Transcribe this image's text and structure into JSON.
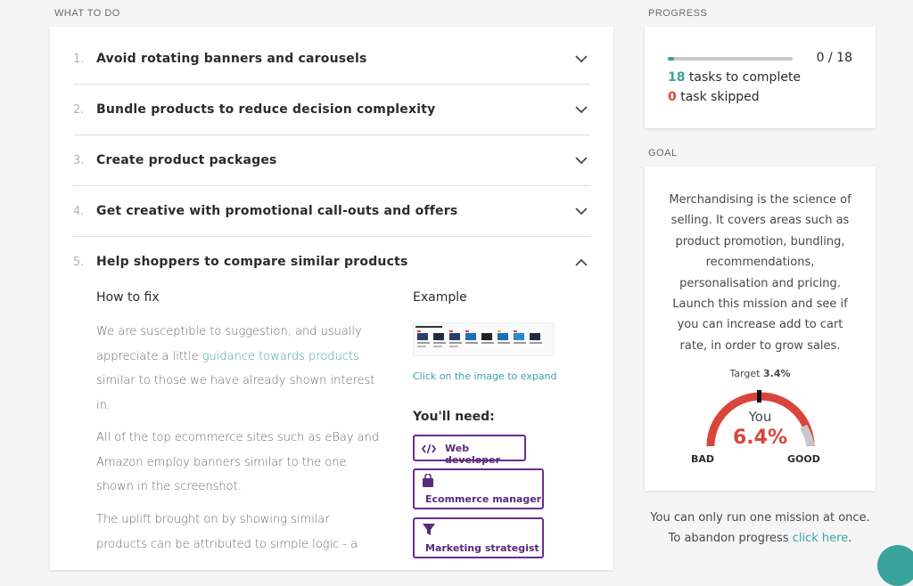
{
  "labels": {
    "what_to_do": "WHAT TO DO",
    "progress": "PROGRESS",
    "goal": "GOAL"
  },
  "tasks": [
    {
      "num": "1.",
      "title": "Avoid rotating banners and carousels"
    },
    {
      "num": "2.",
      "title": "Bundle products to reduce decision complexity"
    },
    {
      "num": "3.",
      "title": "Create product packages"
    },
    {
      "num": "4.",
      "title": "Get creative with promotional call-outs and offers"
    },
    {
      "num": "5.",
      "title": "Help shoppers to compare similar products"
    }
  ],
  "howto": {
    "title": "How to fix",
    "p1_a": "We are susceptible to suggestion, and usually appreciate a little ",
    "p1_link": "guidance towards products",
    "p1_b": " similar to those we have already shown interest in.",
    "p2": "All of the top ecommerce sites such as eBay and Amazon employ banners similar to the one shown in the screenshot.",
    "p3": "The uplift brought on by showing similar products can be attributed to simple logic - a"
  },
  "example": {
    "title": "Example",
    "caption": "Click on the image to expand"
  },
  "need": {
    "title": "You'll need:",
    "roles": [
      "Web developer",
      "Ecommerce manager",
      "Marketing strategist"
    ]
  },
  "progress": {
    "count": "0 / 18",
    "fraction": 0.05,
    "tasks_num": "18",
    "tasks_text": " tasks to complete",
    "skipped_num": "0",
    "skipped_text": " task skipped"
  },
  "goal": {
    "text": "Merchandising is the science of selling. It covers areas such as product promotion, bundling, recommendations, personalisation and pricing. Launch this mission and see if you can increase add to cart rate, in order to grow sales.",
    "target_label": "Target ",
    "target_value": "3.4%",
    "you_label": "You",
    "you_value": "6.4%",
    "bad": "BAD",
    "good": "GOOD",
    "color_bar": "#d9453a"
  },
  "footer": {
    "text": "You can only run one mission at once. To abandon progress ",
    "link": "click here",
    "end": "."
  }
}
